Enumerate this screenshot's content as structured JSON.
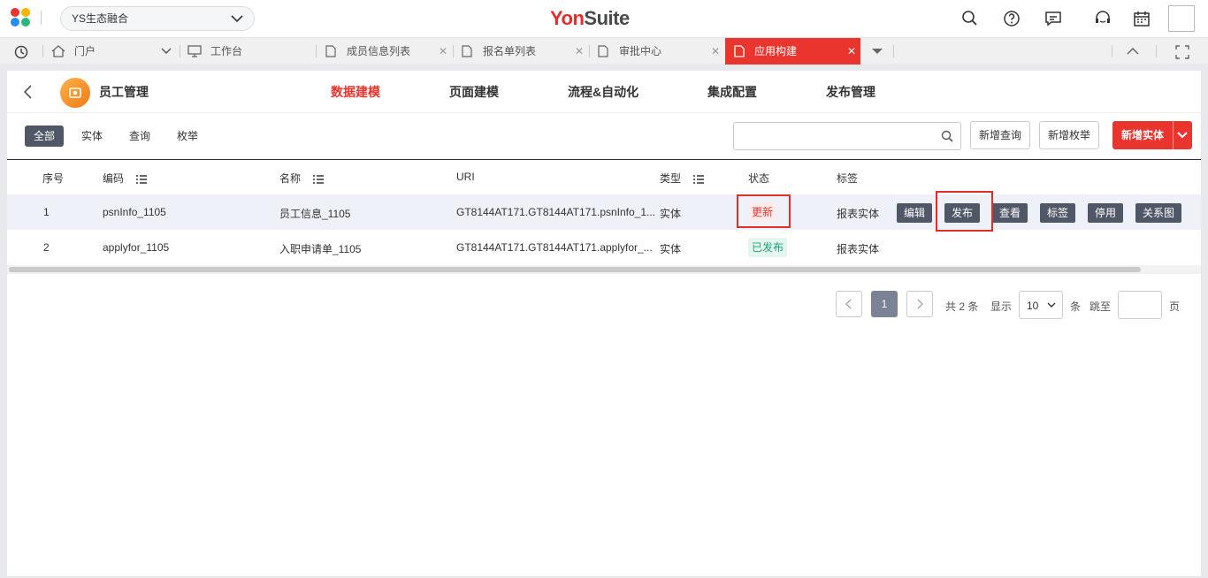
{
  "header": {
    "org_selector": "YS生态融合",
    "brand_part1": "Yon",
    "brand_part2": "Suite",
    "icons": [
      "search-icon",
      "help-icon",
      "message-icon",
      "service-icon",
      "calendar-icon",
      "user-avatar"
    ]
  },
  "tabs": [
    {
      "label": "门户",
      "icon": "home-icon"
    },
    {
      "label": "工作台",
      "icon": "monitor-icon"
    },
    {
      "label": "成员信息列表",
      "icon": "document-icon"
    },
    {
      "label": "报名单列表",
      "icon": "document-icon"
    },
    {
      "label": "审批中心",
      "icon": "document-icon"
    },
    {
      "label": "应用构建",
      "icon": "document-icon",
      "active": true
    }
  ],
  "app": {
    "name": "员工管理",
    "nav": [
      "数据建模",
      "页面建模",
      "流程&自动化",
      "集成配置",
      "发布管理"
    ],
    "active_nav": "数据建模"
  },
  "filters": [
    "全部",
    "实体",
    "查询",
    "枚举"
  ],
  "search": {
    "placeholder": ""
  },
  "buttons": {
    "new_query": "新增查询",
    "new_enum": "新增枚举",
    "new_entity": "新增实体"
  },
  "table": {
    "columns": [
      "序号",
      "编码",
      "名称",
      "URI",
      "类型",
      "状态",
      "标签"
    ],
    "rows": [
      {
        "index": "1",
        "code": "psnInfo_1105",
        "name": "员工信息_1105",
        "uri": "GT8144AT171.GT8144AT171.psnInfo_1...",
        "type": "实体",
        "status": "更新",
        "tag": "报表实体",
        "actions": [
          "编辑",
          "发布",
          "查看",
          "标签",
          "停用",
          "关系图"
        ]
      },
      {
        "index": "2",
        "code": "applyfor_1105",
        "name": "入职申请单_1105",
        "uri": "GT8144AT171.GT8144AT171.applyfor_...",
        "type": "实体",
        "status": "已发布",
        "tag": "报表实体"
      }
    ]
  },
  "pagination": {
    "current": "1",
    "total_text": "共 2 条",
    "show_label": "显示",
    "page_size": "10",
    "unit_label": "条",
    "jump_label": "跳至",
    "page_label": "页"
  },
  "colors": {
    "accent": "#e9352d",
    "dark_button": "#505766",
    "published": "#1aa57a"
  }
}
